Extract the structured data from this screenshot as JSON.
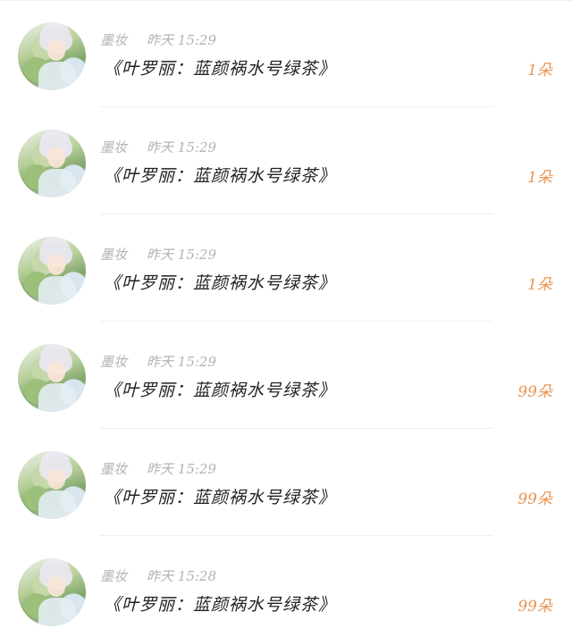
{
  "list": {
    "items": [
      {
        "user": "墨妆",
        "time": "昨天 15:29",
        "gift": "《叶罗丽：蓝颜祸水号绿茶》",
        "count": "1朵"
      },
      {
        "user": "墨妆",
        "time": "昨天 15:29",
        "gift": "《叶罗丽：蓝颜祸水号绿茶》",
        "count": "1朵"
      },
      {
        "user": "墨妆",
        "time": "昨天 15:29",
        "gift": "《叶罗丽：蓝颜祸水号绿茶》",
        "count": "1朵"
      },
      {
        "user": "墨妆",
        "time": "昨天 15:29",
        "gift": "《叶罗丽：蓝颜祸水号绿茶》",
        "count": "99朵"
      },
      {
        "user": "墨妆",
        "time": "昨天 15:29",
        "gift": "《叶罗丽：蓝颜祸水号绿茶》",
        "count": "99朵"
      },
      {
        "user": "墨妆",
        "time": "昨天 15:28",
        "gift": "《叶罗丽：蓝颜祸水号绿茶》",
        "count": "99朵"
      }
    ]
  },
  "colors": {
    "accent": "#e8954f",
    "text": "#222222",
    "muted": "#b3b3b3"
  }
}
